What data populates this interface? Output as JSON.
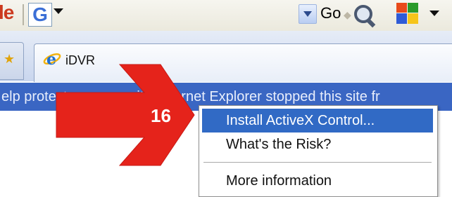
{
  "toolbar": {
    "left_fragment": "le",
    "google_logo": "G",
    "go_label": "Go",
    "icons": [
      "google-icon",
      "search-dropdown-icon",
      "magnifier-icon",
      "home-icon"
    ]
  },
  "tabs": [
    {
      "label": "",
      "icon": "star-icon"
    },
    {
      "label": "iDVR",
      "icon": "ie-icon",
      "active": true
    }
  ],
  "infobar": {
    "text": "elp protect your security, Internet Explorer stopped this site fr"
  },
  "context_menu": {
    "items": [
      {
        "label": "Install ActiveX Control...",
        "highlighted": true
      },
      {
        "label": "What's the Risk?"
      },
      {
        "label": "More information"
      }
    ]
  },
  "annotation": {
    "step_number": "16",
    "arrow_color": "#e5231b"
  },
  "colors": {
    "infobar": "#3a66c3",
    "menu_highlight": "#316ac5"
  }
}
